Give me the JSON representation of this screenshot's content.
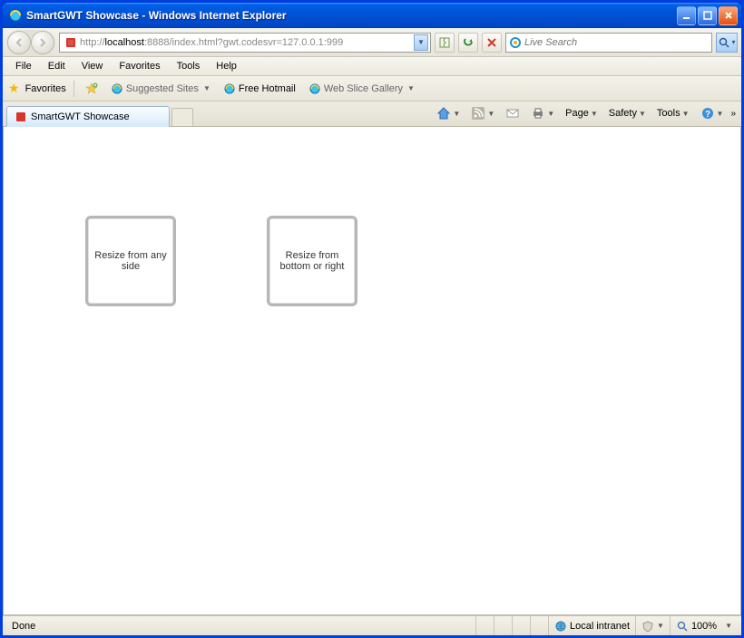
{
  "window": {
    "title": "SmartGWT Showcase - Windows Internet Explorer"
  },
  "address": {
    "prefix": "http://",
    "host": "localhost",
    "suffix": ":8888/index.html?gwt.codesvr=127.0.0.1:999"
  },
  "search": {
    "placeholder": "Live Search"
  },
  "menu": {
    "items": [
      "File",
      "Edit",
      "View",
      "Favorites",
      "Tools",
      "Help"
    ]
  },
  "favbar": {
    "label": "Favorites",
    "suggested": "Suggested Sites",
    "hotmail": "Free Hotmail",
    "slice": "Web Slice Gallery"
  },
  "tab": {
    "title": "SmartGWT Showcase"
  },
  "cmd": {
    "page": "Page",
    "safety": "Safety",
    "tools": "Tools"
  },
  "boxes": {
    "box1": "Resize from any side",
    "box2": "Resize from bottom or right"
  },
  "status": {
    "done": "Done",
    "zone": "Local intranet",
    "zoom": "100%"
  }
}
